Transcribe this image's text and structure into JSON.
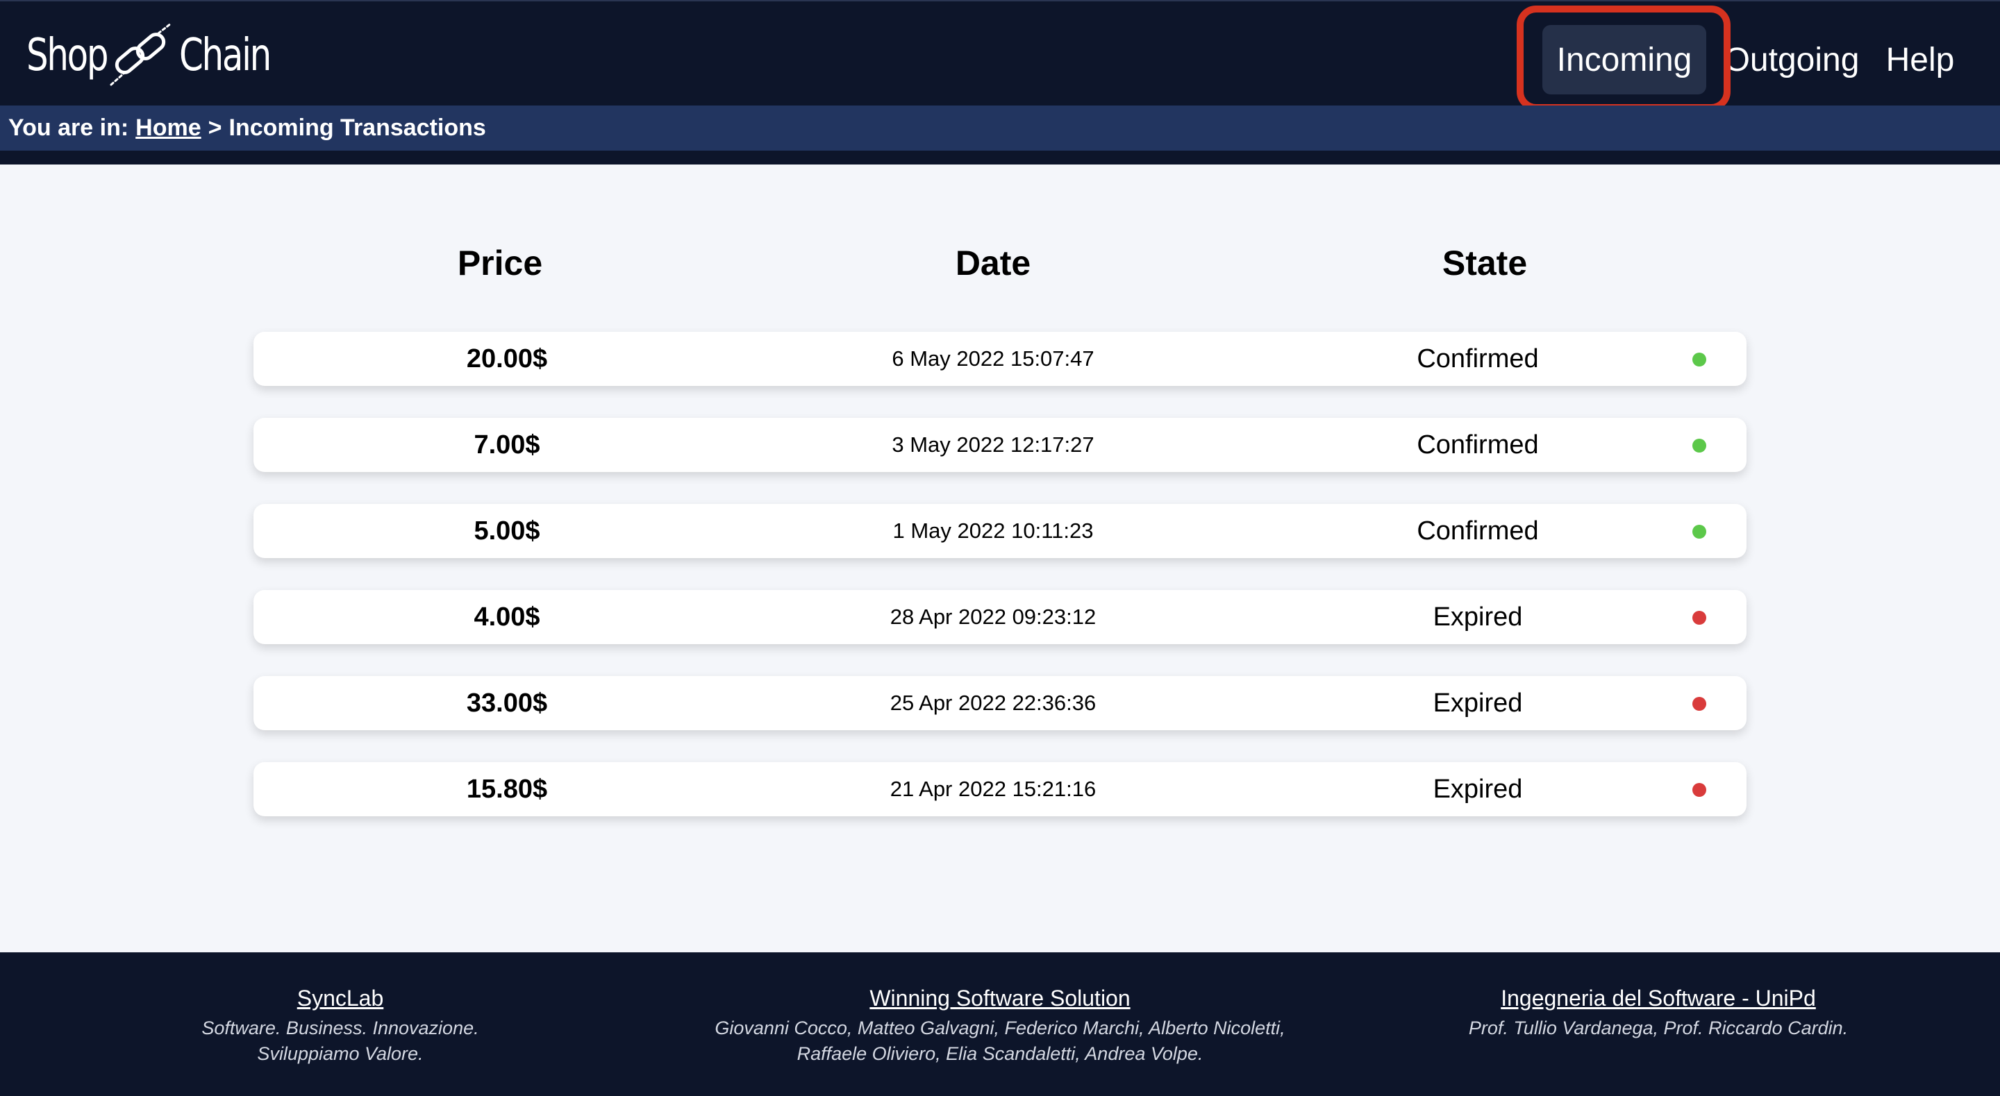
{
  "header": {
    "logo": {
      "word1": "Shop",
      "word2": "Chain",
      "icon": "chain-link-icon"
    },
    "nav": [
      {
        "label": "Incoming",
        "active": true
      },
      {
        "label": "Outgoing",
        "active": false
      },
      {
        "label": "Help",
        "active": false
      }
    ]
  },
  "breadcrumb": {
    "prefix": "You are in:",
    "home": "Home",
    "separator": ">",
    "current": "Incoming Transactions"
  },
  "table": {
    "headers": {
      "price": "Price",
      "date": "Date",
      "state": "State"
    },
    "rows": [
      {
        "price": "20.00$",
        "date": "6 May 2022 15:07:47",
        "state": "Confirmed",
        "status_color": "#5cc84a"
      },
      {
        "price": "7.00$",
        "date": "3 May 2022 12:17:27",
        "state": "Confirmed",
        "status_color": "#5cc84a"
      },
      {
        "price": "5.00$",
        "date": "1 May 2022 10:11:23",
        "state": "Confirmed",
        "status_color": "#5cc84a"
      },
      {
        "price": "4.00$",
        "date": "28 Apr 2022 09:23:12",
        "state": "Expired",
        "status_color": "#d93b3b"
      },
      {
        "price": "33.00$",
        "date": "25 Apr 2022 22:36:36",
        "state": "Expired",
        "status_color": "#d93b3b"
      },
      {
        "price": "15.80$",
        "date": "21 Apr 2022 15:21:16",
        "state": "Expired",
        "status_color": "#d93b3b"
      }
    ]
  },
  "footer": [
    {
      "title": "SyncLab",
      "lines": [
        "Software. Business. Innovazione.",
        "Sviluppiamo Valore."
      ]
    },
    {
      "title": "Winning Software Solution",
      "lines": [
        "Giovanni Cocco, Matteo Galvagni, Federico Marchi, Alberto Nicoletti,",
        "Raffaele Oliviero, Elia Scandaletti, Andrea Volpe."
      ]
    },
    {
      "title": "Ingegneria del Software - UniPd",
      "lines": [
        "Prof. Tullio Vardanega, Prof. Riccardo Cardin."
      ]
    }
  ],
  "colors": {
    "header_bg": "#0d152a",
    "breadcrumb_bg": "#223560",
    "active_nav_bg": "#253049",
    "highlight_border": "#d6321f",
    "confirmed": "#5cc84a",
    "expired": "#d93b3b"
  }
}
